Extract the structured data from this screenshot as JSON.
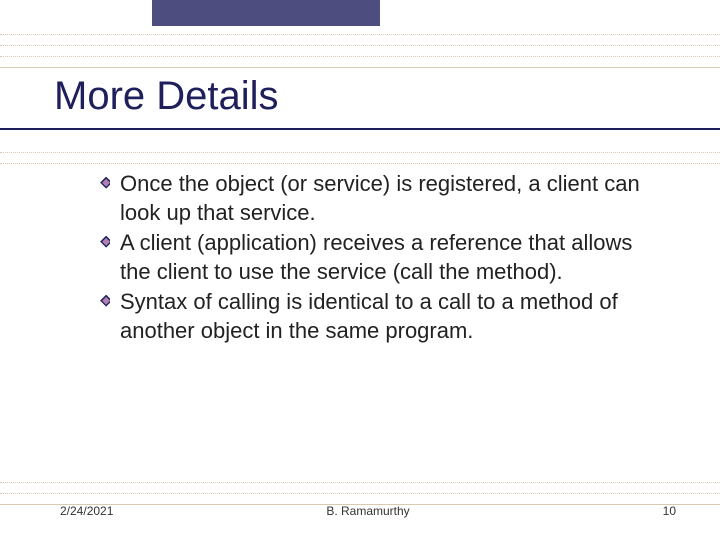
{
  "title": "More Details",
  "bullets": [
    "Once the object (or service) is registered, a client can look up that service.",
    "A client (application) receives a reference that allows the client to use the service (call the method).",
    "Syntax of calling is identical to a call to a method of another object in the same program."
  ],
  "footer": {
    "date": "2/24/2021",
    "author": "B. Ramamurthy",
    "page": "10"
  },
  "colors": {
    "titleColor": "#1f1f5c",
    "barColor": "#4d4d80",
    "ruleColor": "#d9c9b3"
  }
}
